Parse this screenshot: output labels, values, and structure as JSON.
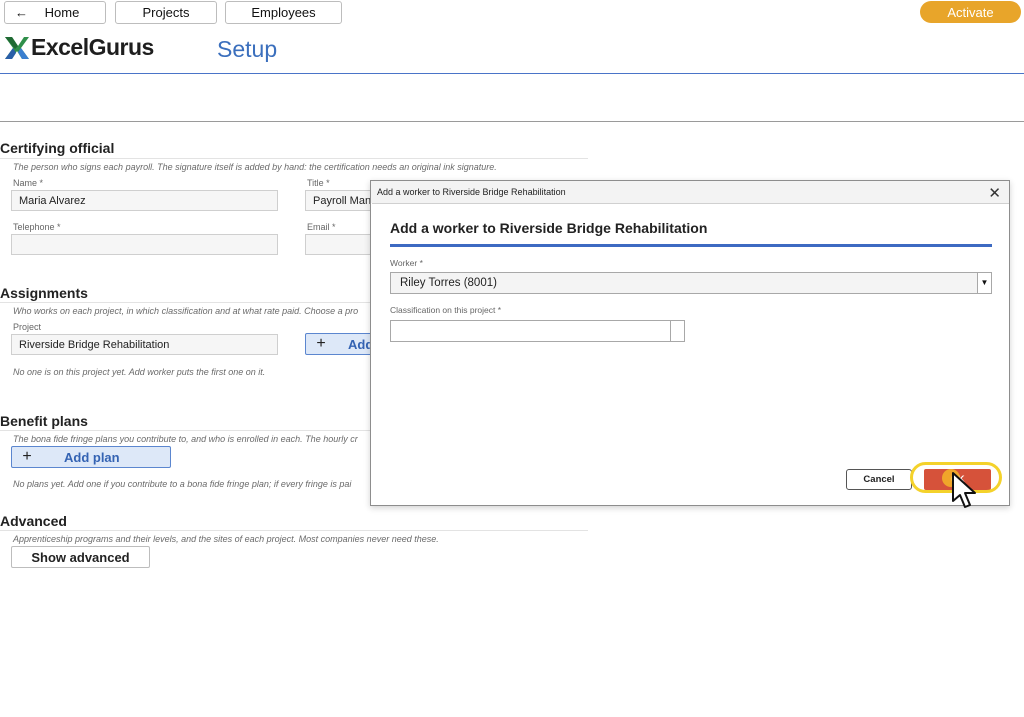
{
  "nav": {
    "home_label": "Home",
    "projects_label": "Projects",
    "employees_label": "Employees",
    "activate_label": "Activate"
  },
  "brand": {
    "logo_text": "ExcelGurus",
    "page_title": "Setup"
  },
  "certifying": {
    "title": "Certifying official",
    "hint": "The person who signs each payroll. The signature itself is added by hand: the certification needs an original ink signature.",
    "name_label": "Name *",
    "name_value": "Maria Alvarez",
    "title_label": "Title *",
    "title_value": "Payroll Man",
    "telephone_label": "Telephone *",
    "telephone_value": "",
    "email_label": "Email *",
    "email_value": ""
  },
  "assignments": {
    "title": "Assignments",
    "hint": "Who works on each project, in which classification and at what rate paid. Choose a pro",
    "project_label": "Project",
    "project_value": "Riverside Bridge Rehabilitation",
    "add_worker_label": "Add",
    "empty_note": "No one is on this project yet. Add worker puts the first one on it."
  },
  "benefits": {
    "title": "Benefit plans",
    "hint": "The bona fide fringe plans you contribute to, and who is enrolled in each. The hourly cr",
    "add_plan_label": "Add plan",
    "empty_note": "No plans yet. Add one if you contribute to a bona fide fringe plan; if every fringe is pai"
  },
  "advanced": {
    "title": "Advanced",
    "hint": "Apprenticeship programs and their levels, and the sites of each project. Most companies never need these.",
    "show_label": "Show advanced"
  },
  "dialog": {
    "window_title": "Add a worker to Riverside Bridge Rehabilitation",
    "heading": "Add a worker to Riverside Bridge Rehabilitation",
    "worker_label": "Worker *",
    "worker_value": "Riley Torres (8001)",
    "classification_label": "Classification on this project *",
    "classification_value": "",
    "cancel_label": "Cancel",
    "ok_label": "OK"
  },
  "colors": {
    "accent_blue": "#3b6fbd",
    "activate": "#e8a52a",
    "ok_button": "#d6523a",
    "highlight": "#f4d22b"
  }
}
